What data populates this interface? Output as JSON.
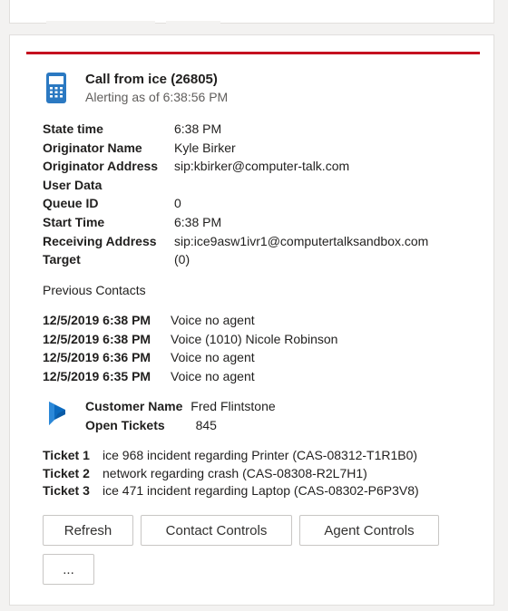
{
  "call": {
    "title": "Call from ice (26805)",
    "subtitle": "Alerting as of 6:38:56 PM"
  },
  "fields": [
    {
      "label": "State time",
      "value": "6:38 PM"
    },
    {
      "label": "Originator Name",
      "value": "Kyle Birker"
    },
    {
      "label": "Originator Address",
      "value": "sip:kbirker@computer-talk.com"
    },
    {
      "label": "User Data",
      "value": ""
    },
    {
      "label": "Queue ID",
      "value": "0"
    },
    {
      "label": "Start Time",
      "value": "6:38 PM"
    },
    {
      "label": "Receiving Address",
      "value": "sip:ice9asw1ivr1@computertalksandbox.com"
    },
    {
      "label": "Target",
      "value": "(0)"
    }
  ],
  "previous_contacts": {
    "title": "Previous Contacts",
    "items": [
      {
        "date": "12/5/2019 6:38 PM",
        "desc": "Voice no agent"
      },
      {
        "date": "12/5/2019 6:38 PM",
        "desc": "Voice (1010) Nicole Robinson"
      },
      {
        "date": "12/5/2019 6:36 PM",
        "desc": "Voice no agent"
      },
      {
        "date": "12/5/2019 6:35 PM",
        "desc": "Voice no agent"
      }
    ]
  },
  "crm": {
    "customer_label": "Customer Name",
    "customer_value": "Fred Flintstone",
    "tickets_label": "Open Tickets",
    "tickets_value": "845"
  },
  "tickets": [
    {
      "label": "Ticket 1",
      "desc": "ice 968 incident regarding Printer (CAS-08312-T1R1B0)"
    },
    {
      "label": "Ticket 2",
      "desc": "network regarding crash (CAS-08308-R2L7H1)"
    },
    {
      "label": "Ticket 3",
      "desc": "ice 471 incident regarding Laptop (CAS-08302-P6P3V8)"
    }
  ],
  "buttons": {
    "refresh": "Refresh",
    "contact_controls": "Contact Controls",
    "agent_controls": "Agent Controls",
    "more": "..."
  },
  "colors": {
    "accent_red": "#c50f1f",
    "phone_icon_blue": "#2b79c2",
    "dynamics_blue": "#0b6abf"
  },
  "icons": {
    "phone": "mobile-phone-icon",
    "crm": "dynamics-365-icon"
  }
}
